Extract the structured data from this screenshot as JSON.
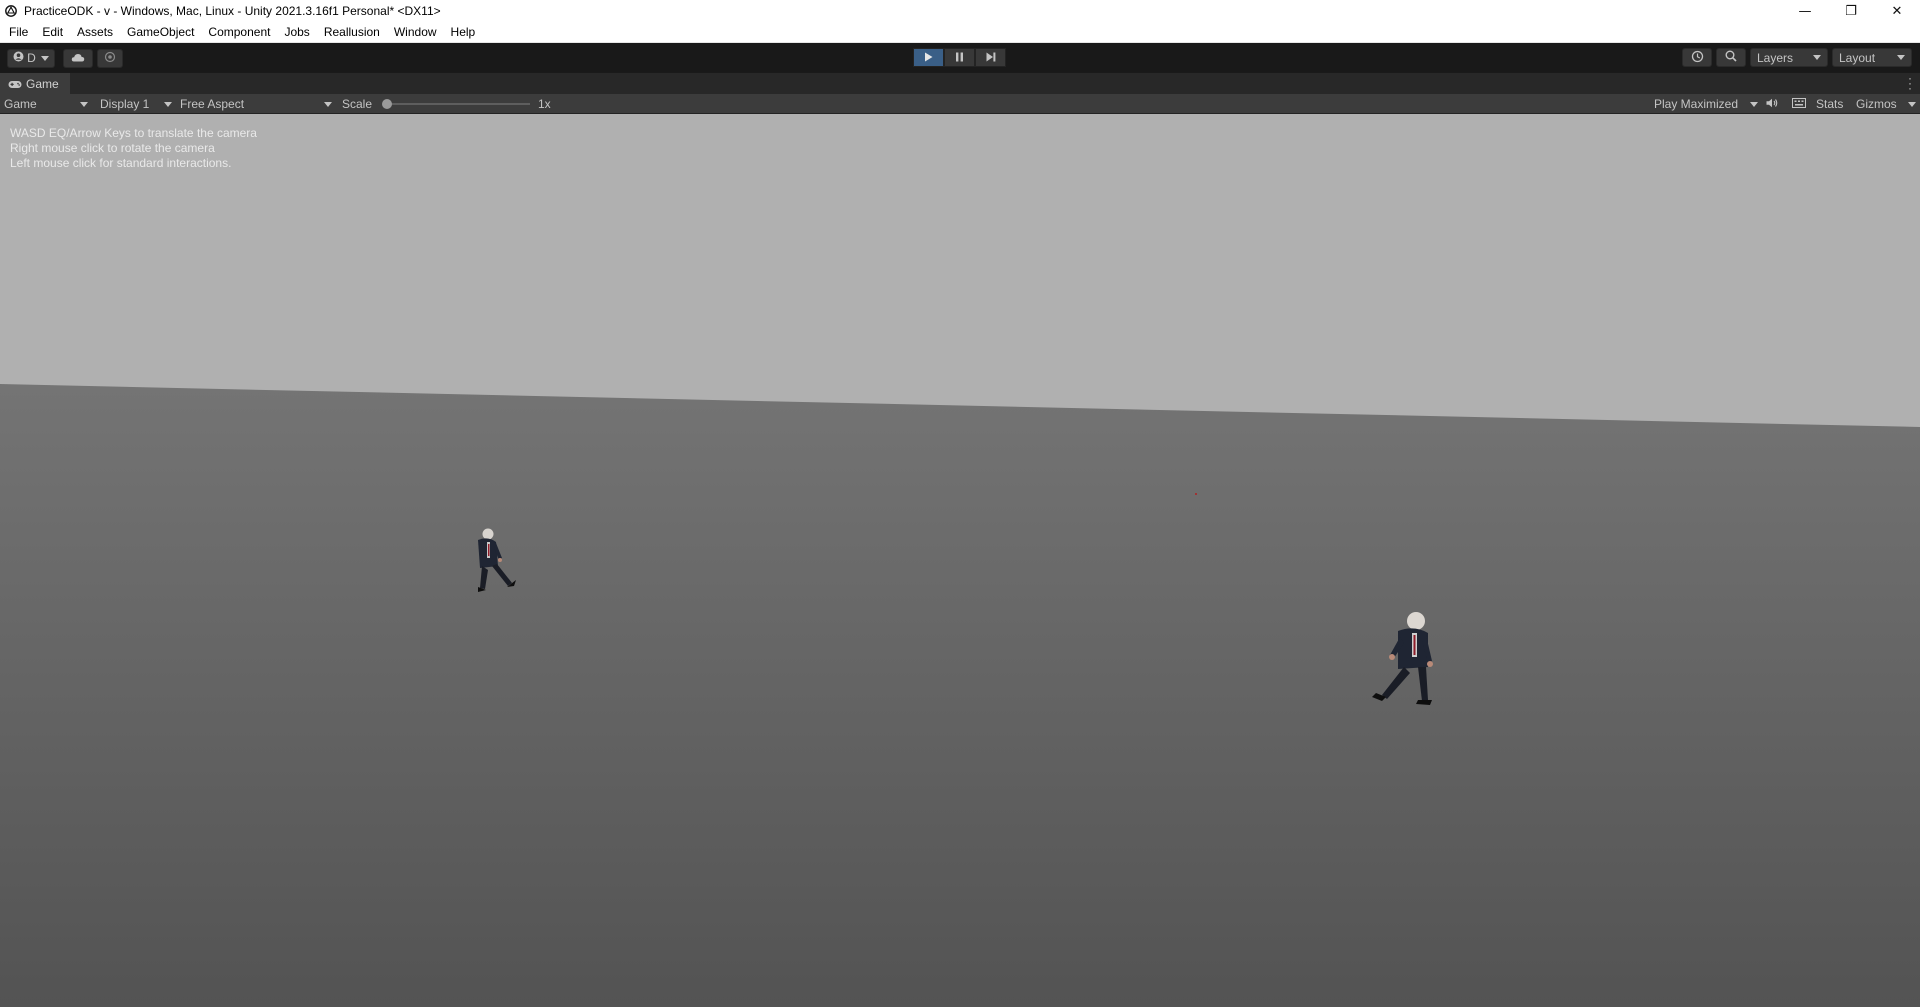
{
  "window": {
    "title": "PracticeODK - v - Windows, Mac, Linux - Unity 2021.3.16f1 Personal* <DX11>",
    "controls": {
      "minimize": "—",
      "restore": "❐",
      "close": "✕"
    }
  },
  "menu": [
    "File",
    "Edit",
    "Assets",
    "GameObject",
    "Component",
    "Jobs",
    "Reallusion",
    "Window",
    "Help"
  ],
  "toolbar": {
    "account_label": "D",
    "play_state": "playing",
    "layers_label": "Layers",
    "layout_label": "Layout"
  },
  "tab": {
    "label": "Game"
  },
  "game_toolbar": {
    "view_mode": "Game",
    "display": "Display 1",
    "aspect": "Free Aspect",
    "scale_label": "Scale",
    "scale_value": "1x",
    "play_mode": "Play Maximized",
    "stats": "Stats",
    "gizmos": "Gizmos"
  },
  "viewport": {
    "help_lines": [
      "WASD EQ/Arrow Keys to translate the camera",
      "Right mouse click to rotate the camera",
      "Left mouse click for standard interactions."
    ],
    "colors": {
      "sky": "#b0b0b0",
      "ground_far": "#6f6f6f",
      "ground_near": "#545454"
    }
  }
}
